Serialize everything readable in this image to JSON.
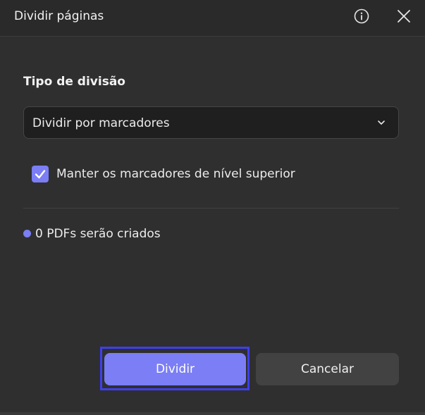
{
  "dialog": {
    "title": "Dividir páginas"
  },
  "split_type": {
    "label": "Tipo de divisão",
    "selected": "Dividir por marcadores"
  },
  "keep_top_level": {
    "label": "Manter os marcadores de nível superior",
    "checked": true
  },
  "status": {
    "text": "0 PDFs serão criados"
  },
  "buttons": {
    "split_label": "Dividir",
    "cancel_label": "Cancelar"
  },
  "colors": {
    "accent": "#7b7ef5",
    "focus_ring": "#3e3ef0",
    "background": "#2f2f2f"
  },
  "icons": {
    "info": "info-icon",
    "close": "close-icon",
    "dropdown": "chevron-down-icon",
    "check": "checkmark-icon"
  }
}
